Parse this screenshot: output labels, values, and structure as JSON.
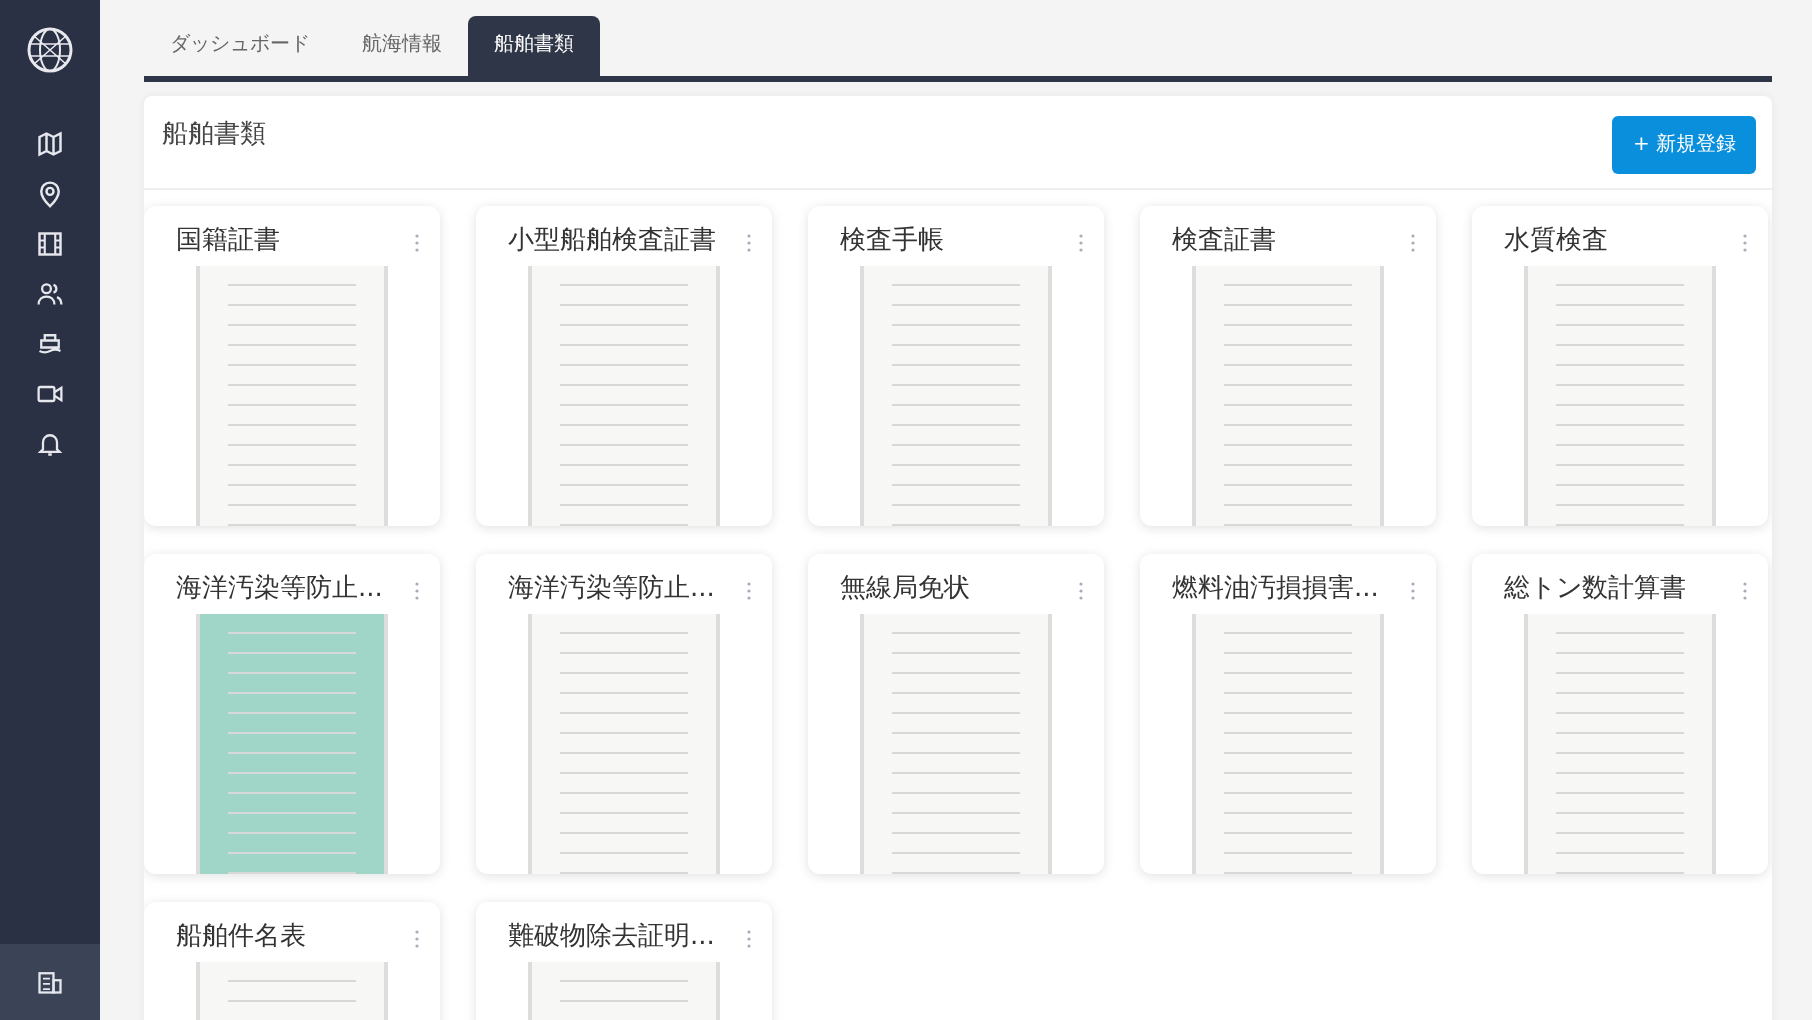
{
  "sidebar": {
    "items": [
      {
        "kind": "map",
        "selected": false
      },
      {
        "kind": "pin",
        "selected": false
      },
      {
        "kind": "film",
        "selected": false
      },
      {
        "kind": "people",
        "selected": false
      },
      {
        "kind": "ship",
        "selected": false
      },
      {
        "kind": "video",
        "selected": false
      },
      {
        "kind": "bell",
        "selected": false
      }
    ],
    "bottom_item": {
      "kind": "building",
      "selected": true
    }
  },
  "tabs": [
    {
      "label": "ダッシュボード",
      "selected": false
    },
    {
      "label": "航海情報",
      "selected": false
    },
    {
      "label": "船舶書類",
      "selected": true
    }
  ],
  "panel": {
    "title": "船舶書類",
    "new_button": {
      "icon": "+",
      "label": "新規登録"
    }
  },
  "documents": [
    {
      "title": "国籍証書"
    },
    {
      "title": "小型船舶検査証書"
    },
    {
      "title": "検査手帳"
    },
    {
      "title": "検査証書"
    },
    {
      "title": "水質検査"
    },
    {
      "title": "海洋汚染等防止...",
      "color": "#9fd6c8"
    },
    {
      "title": "海洋汚染等防止..."
    },
    {
      "title": "無線局免状"
    },
    {
      "title": "燃料油汚損損害..."
    },
    {
      "title": "総トン数計算書"
    },
    {
      "title": "船舶件名表"
    },
    {
      "title": "難破物除去証明..."
    }
  ]
}
